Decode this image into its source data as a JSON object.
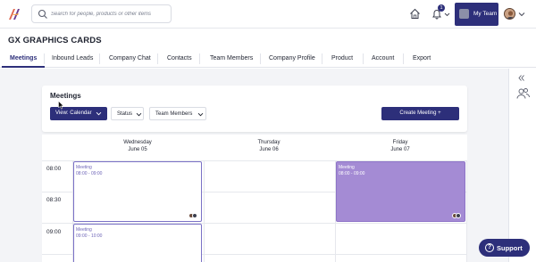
{
  "header": {
    "search_placeholder": "Search for people, products or other items",
    "notification_count": "1",
    "team_button_label": "My Team"
  },
  "company": {
    "title": "GX GRAPHICS CARDS"
  },
  "tabs": [
    {
      "label": "Meetings",
      "active": true
    },
    {
      "label": "Inbound Leads"
    },
    {
      "label": "Company Chat"
    },
    {
      "label": "Contacts"
    },
    {
      "label": "Team Members"
    },
    {
      "label": "Company Profile"
    },
    {
      "label": "Product"
    },
    {
      "label": "Account"
    },
    {
      "label": "Export"
    }
  ],
  "meetings_panel": {
    "title": "Meetings",
    "view_label": "View: Calendar",
    "status_label": "Status",
    "team_members_label": "Team Members",
    "create_label": "Create Meeting +"
  },
  "calendar": {
    "days": [
      {
        "weekday": "Wednesday",
        "date": "June 05"
      },
      {
        "weekday": "Thursday",
        "date": "June 06"
      },
      {
        "weekday": "Friday",
        "date": "June 07"
      }
    ],
    "times": [
      "08:00",
      "08:30",
      "09:00"
    ],
    "events": [
      {
        "title": "Meeting",
        "time": "08:00 - 09:00"
      },
      {
        "title": "Meeting",
        "time": "08:00 - 09:00"
      },
      {
        "title": "Meeting",
        "time": "09:00 - 10:00"
      }
    ]
  },
  "support": {
    "label": "Support"
  },
  "colors": {
    "primary": "#2d2f7a",
    "event_fill": "#a48bd4",
    "event_outline": "#7b72c6"
  }
}
